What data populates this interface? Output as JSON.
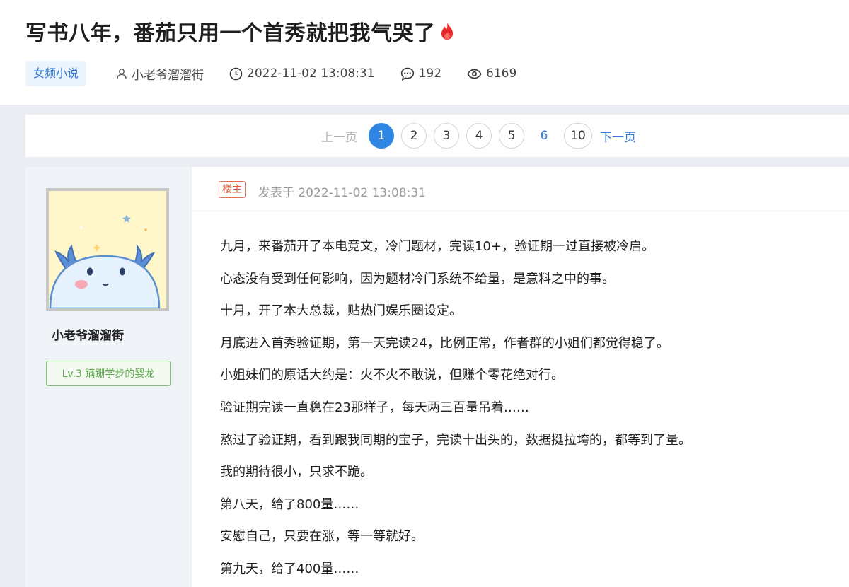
{
  "title": "写书八年，番茄只用一个首秀就把我气哭了",
  "meta": {
    "category": "女频小说",
    "author": "小老爷溜溜街",
    "datetime": "2022-11-02 13:08:31",
    "comments": "192",
    "views": "6169"
  },
  "pagination": {
    "prev": "上一页",
    "next": "下一页",
    "pages": [
      "1",
      "2",
      "3",
      "4",
      "5",
      "6",
      "10"
    ],
    "current": "1"
  },
  "user": {
    "name": "小老爷溜溜街",
    "level": "Lv.3 蹒跚学步的婴龙"
  },
  "post": {
    "badge": "楼主",
    "posted": "发表于 2022-11-02 13:08:31",
    "paragraphs": [
      "九月，来番茄开了本电竞文，冷门题材，完读10+，验证期一过直接被冷启。",
      "心态没有受到任何影响，因为题材冷门系统不给量，是意料之中的事。",
      "十月，开了本大总裁，贴热门娱乐圈设定。",
      "月底进入首秀验证期，第一天完读24，比例正常，作者群的小姐们都觉得稳了。",
      "小姐妹们的原话大约是：火不火不敢说，但赚个零花绝对行。",
      "验证期完读一直稳在23那样子，每天两三百量吊着……",
      "熬过了验证期，看到跟我同期的宝子，完读十出头的，数据挺拉垮的，都等到了量。",
      "我的期待很小，只求不跪。",
      "第八天，给了800量……",
      "安慰自己，只要在涨，等一等就好。",
      "第九天，给了400量……"
    ]
  },
  "colors": {
    "accent": "#2f86e2",
    "link": "#2f7bd8",
    "op_badge": "#e0563a",
    "level_green": "#59a847",
    "fire": "#e8282b"
  }
}
